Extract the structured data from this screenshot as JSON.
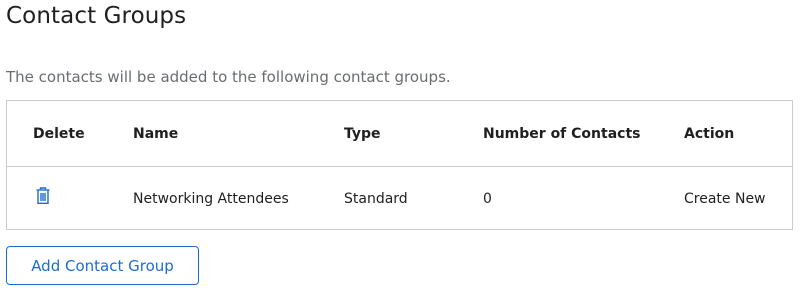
{
  "page": {
    "title": "Contact Groups",
    "description": "The contacts will be added to the following contact groups."
  },
  "table": {
    "headers": {
      "delete": "Delete",
      "name": "Name",
      "type": "Type",
      "count": "Number of Contacts",
      "action": "Action"
    },
    "rows": [
      {
        "delete_icon": "trash-icon",
        "name": "Networking Attendees",
        "type": "Standard",
        "count": "0",
        "action": "Create New"
      }
    ]
  },
  "add_button_label": "Add Contact Group",
  "colors": {
    "accent": "#1c6dd0",
    "border": "#c9cbcd",
    "muted_text": "#6a6d70"
  }
}
